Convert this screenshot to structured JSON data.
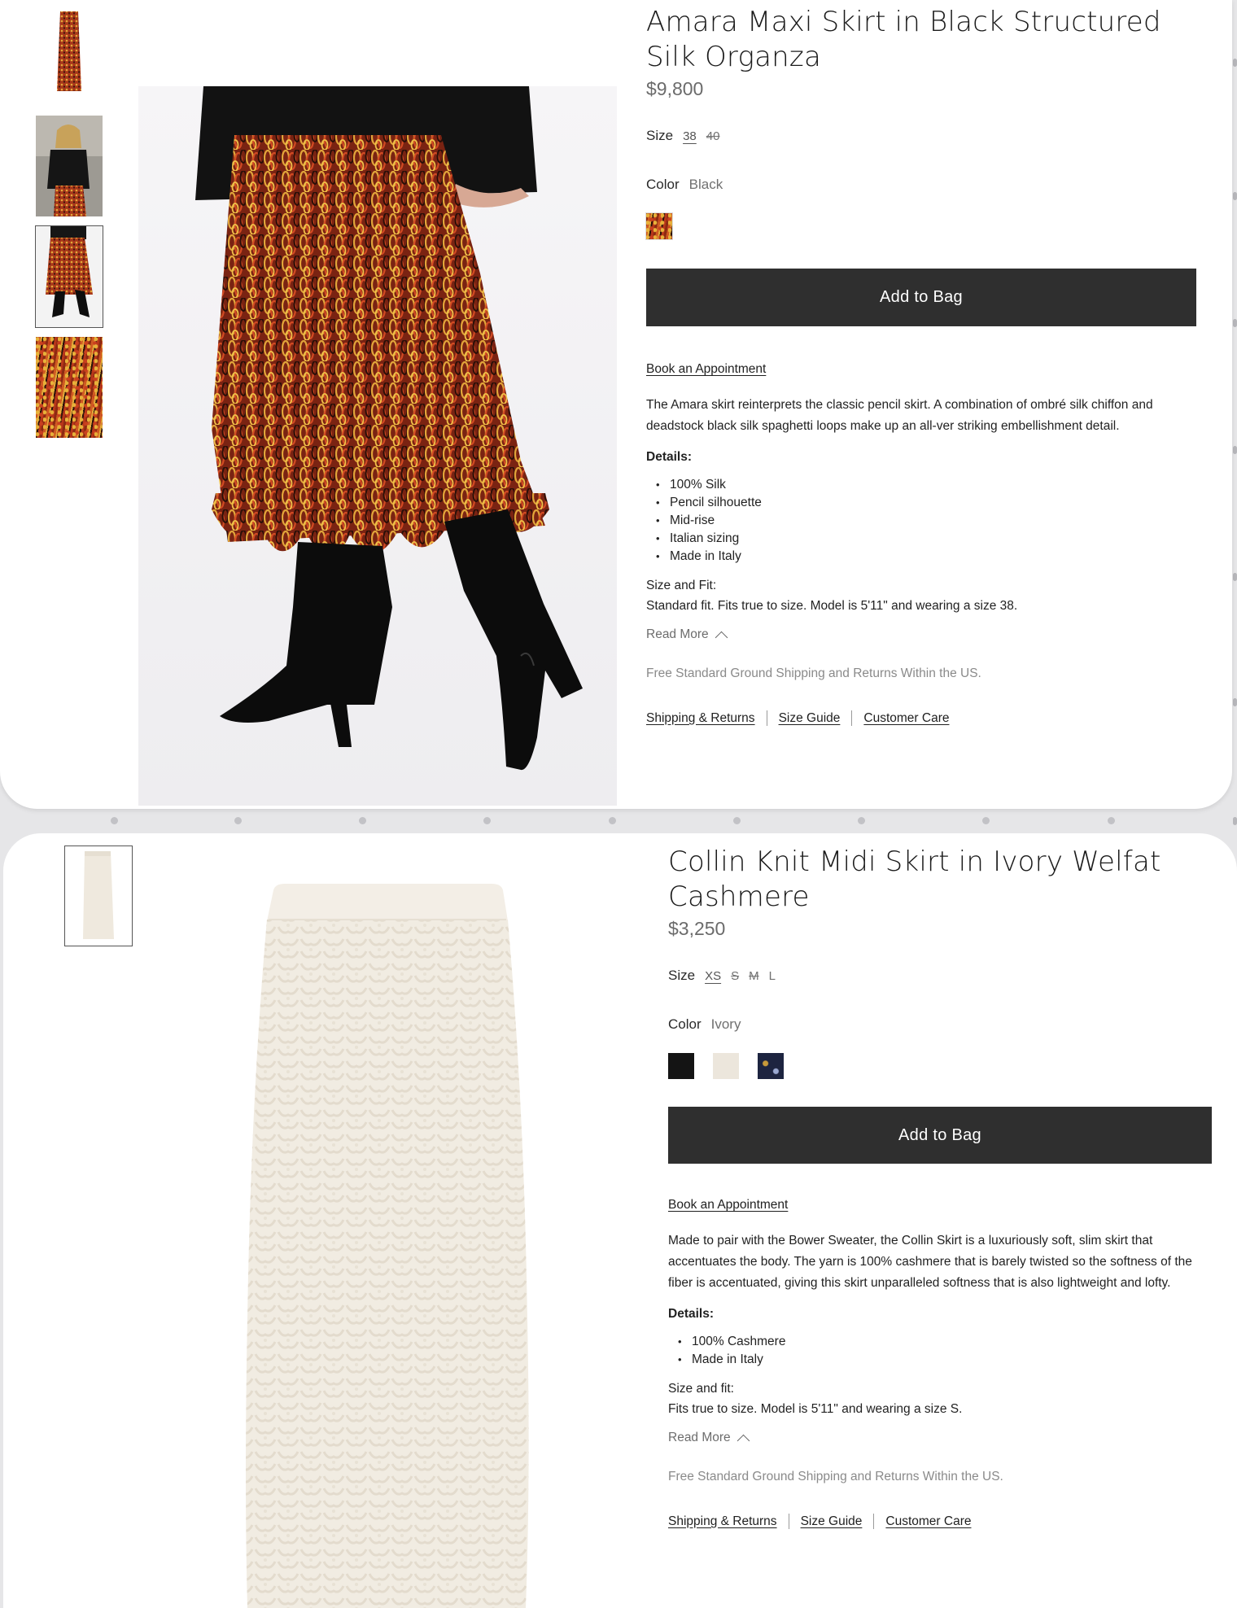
{
  "products": [
    {
      "title": "Amara Maxi Skirt in Black Structured Silk Organza",
      "price": "$9,800",
      "size_label": "Size",
      "sizes": [
        "38",
        "40"
      ],
      "color_label": "Color",
      "color_value": "Black",
      "add_to_bag": "Add to Bag",
      "book_appointment": "Book an Appointment",
      "description": "The Amara skirt reinterprets the classic pencil skirt. A combination of ombré silk chiffon and deadstock black silk spaghetti loops make up an all-ver striking embellishment detail.",
      "details_heading": "Details:",
      "details": [
        "100% Silk",
        "Pencil silhouette",
        "Mid-rise",
        "Italian sizing",
        "Made in Italy"
      ],
      "fit_heading": "Size and Fit:",
      "fit_text": "Standard fit. Fits true to size. Model is 5'11\" and wearing a size 38.",
      "read_more": "Read More",
      "shipping_note": "Free Standard Ground Shipping and Returns Within the US.",
      "footer_links": [
        "Shipping & Returns",
        "Size Guide",
        "Customer Care"
      ]
    },
    {
      "title": "Collin Knit Midi Skirt in Ivory Welfat Cashmere",
      "price": "$3,250",
      "size_label": "Size",
      "sizes": [
        "XS",
        "S",
        "M",
        "L"
      ],
      "color_label": "Color",
      "color_value": "Ivory",
      "add_to_bag": "Add to Bag",
      "book_appointment": "Book an Appointment",
      "description": "Made to pair with the Bower Sweater, the Collin Skirt is a luxuriously soft, slim skirt that accentuates the body. The yarn is 100% cashmere that is barely twisted so the softness of the fiber is accentuated, giving this skirt unparalleled softness that is also lightweight and lofty.",
      "details_heading": "Details:",
      "details": [
        "100% Cashmere",
        "Made in Italy"
      ],
      "fit_heading": "Size and fit:",
      "fit_text": "Fits true to size. Model is 5'11\" and wearing a size S.",
      "read_more": "Read More",
      "shipping_note": "Free Standard Ground Shipping and Returns Within the US.",
      "footer_links": [
        "Shipping & Returns",
        "Size Guide",
        "Customer Care"
      ]
    }
  ],
  "colors": {
    "button_bg": "#2f2f2f",
    "price": "#6b6b6b",
    "muted": "#8a8a8a",
    "swatch_black": "#141414",
    "swatch_ivory": "#ece6dc",
    "swatch_navy_gold": "#1d2440"
  }
}
